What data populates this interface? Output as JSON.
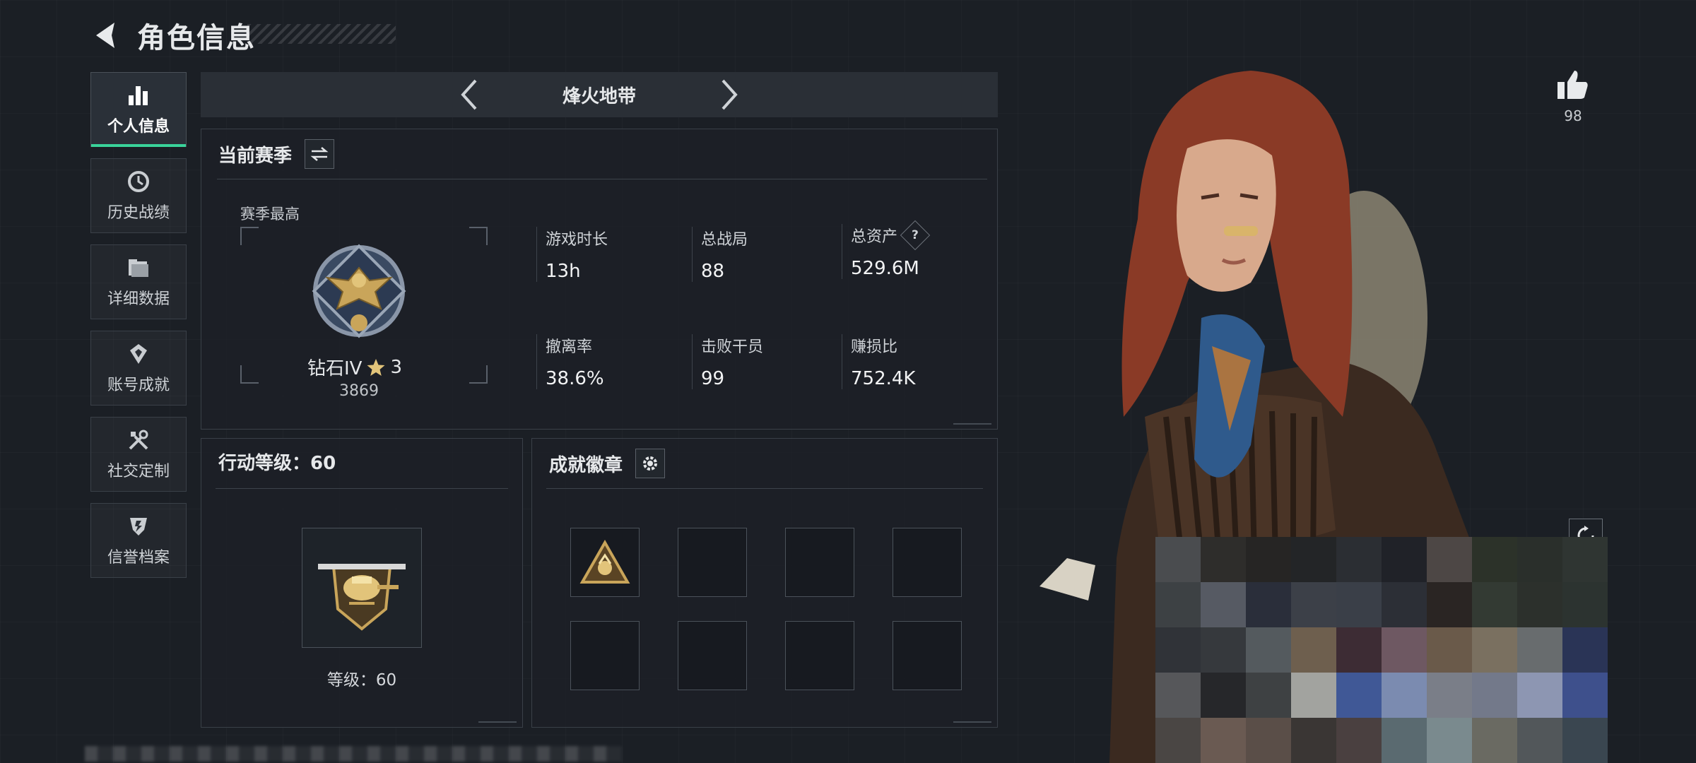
{
  "header": {
    "title": "角色信息"
  },
  "sidebar": {
    "items": [
      {
        "label": "个人信息",
        "icon": "bar-chart-icon",
        "active": true
      },
      {
        "label": "历史战绩",
        "icon": "history-icon",
        "active": false
      },
      {
        "label": "详细数据",
        "icon": "folder-icon",
        "active": false
      },
      {
        "label": "账号成就",
        "icon": "achievement-icon",
        "active": false
      },
      {
        "label": "社交定制",
        "icon": "tools-icon",
        "active": false
      },
      {
        "label": "信誉档案",
        "icon": "shield-icon",
        "active": false
      }
    ]
  },
  "mode": {
    "title": "烽火地带"
  },
  "season": {
    "title": "当前赛季",
    "best_label": "赛季最高",
    "rank": "钻石IV",
    "stars": "3",
    "points": "3869",
    "stats": [
      {
        "label": "游戏时长",
        "value": "13h"
      },
      {
        "label": "总战局",
        "value": "88"
      },
      {
        "label": "总资产",
        "value": "529.6M"
      },
      {
        "label": "撤离率",
        "value": "38.6%"
      },
      {
        "label": "击败干员",
        "value": "99"
      },
      {
        "label": "赚损比",
        "value": "752.4K"
      }
    ],
    "help_glyph": "?"
  },
  "level": {
    "title": "行动等级：60",
    "label": "等级：60"
  },
  "badges": {
    "title": "成就徽章"
  },
  "likes": {
    "count": "98"
  },
  "colors": {
    "accent": "#39d39a",
    "background": "#1b1f25",
    "gold": "#c9a55a"
  }
}
